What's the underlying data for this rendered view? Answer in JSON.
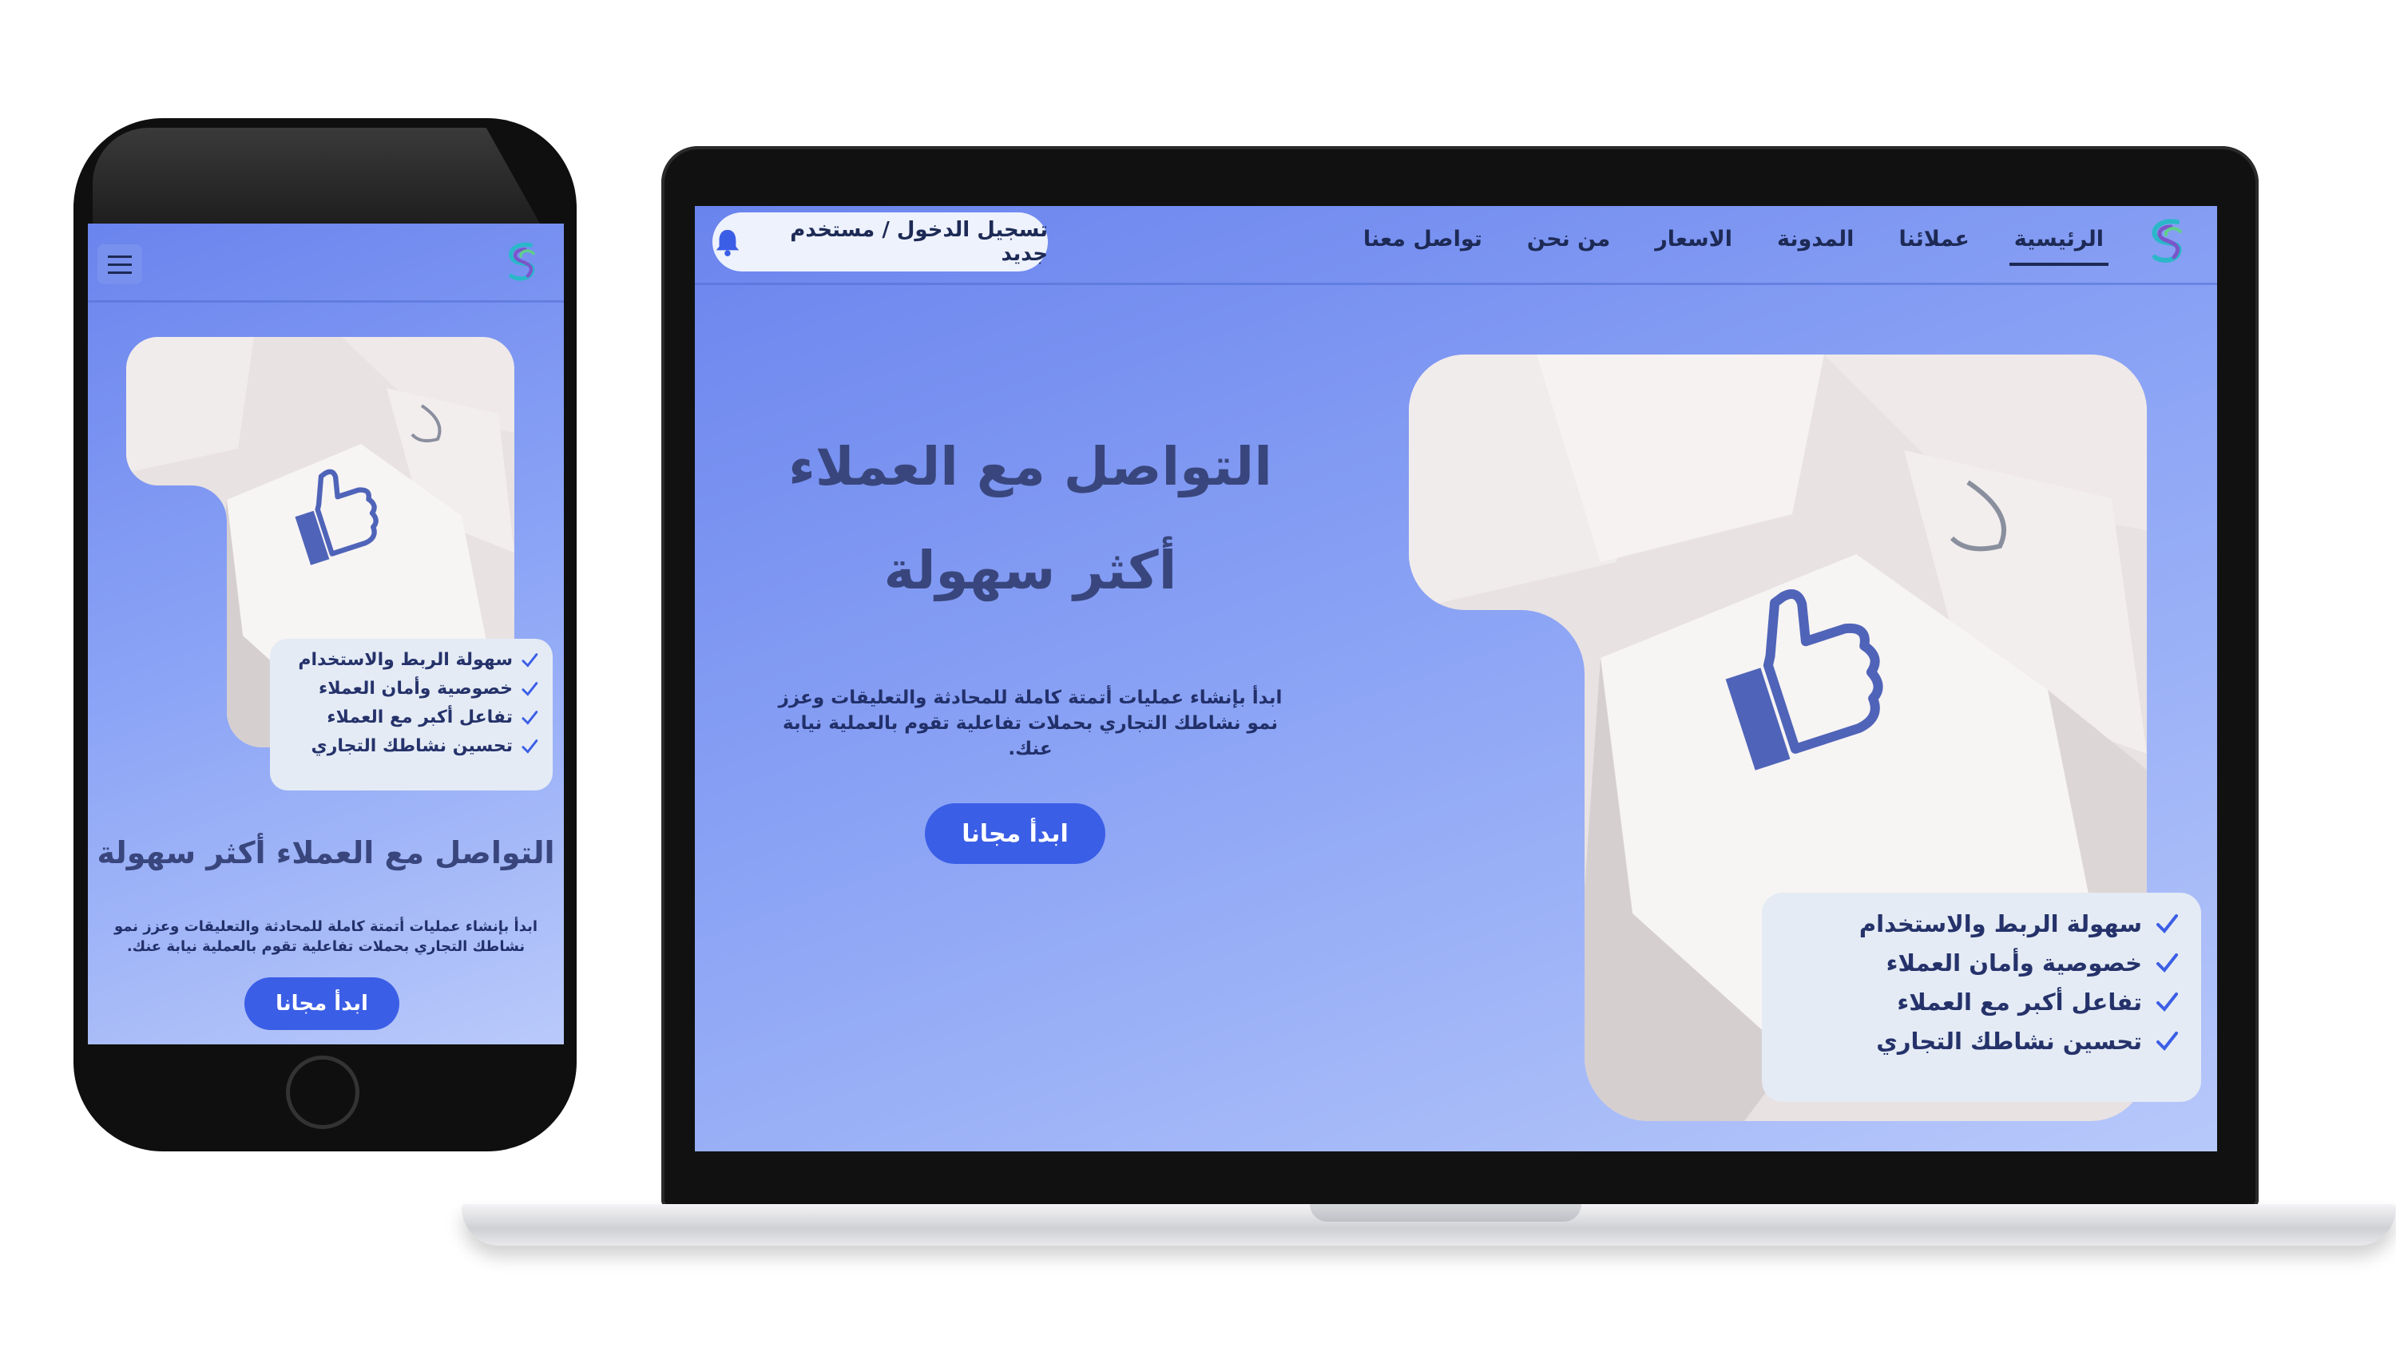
{
  "desktop": {
    "nav": {
      "items": [
        {
          "label": "الرئيسية",
          "active": true
        },
        {
          "label": "عملائنا"
        },
        {
          "label": "المدونة"
        },
        {
          "label": "الاسعار"
        },
        {
          "label": "من نحن"
        },
        {
          "label": "تواصل معنا"
        }
      ],
      "login": "تسجيل الدخول / مستخدم جديد"
    },
    "hero": {
      "title": "التواصل مع العملاء أكثر سهولة",
      "description": "ابدأ بإنشاء عمليات أتمتة كاملة للمحادثة والتعليقات وعزز نمو نشاطك التجاري بحملات تفاعلية تقوم بالعملية نيابة عنك.",
      "cta": "ابدأ مجانا"
    },
    "features": [
      "سهولة الربط والاستخدام",
      "خصوصية وأمان العملاء",
      "تفاعل أكبر مع العملاء",
      "تحسين نشاطك التجاري"
    ]
  },
  "mobile": {
    "hero": {
      "title": "التواصل مع العملاء أكثر سهولة",
      "description": "ابدأ بإنشاء عمليات أتمتة كاملة للمحادثة والتعليقات وعزز نمو نشاطك التجاري بحملات تفاعلية تقوم بالعملية نيابة عنك.",
      "cta": "ابدأ مجانا"
    },
    "features": [
      "سهولة الربط والاستخدام",
      "خصوصية وأمان العملاء",
      "تفاعل أكبر مع العملاء",
      "تحسين نشاطك التجاري"
    ]
  },
  "icons": {
    "logo": "logo-icon",
    "bell": "bell-icon",
    "check": "check-icon",
    "menu": "hamburger-menu-icon",
    "thumbs_up": "thumbs-up-icon"
  },
  "colors": {
    "accent": "#3b5ee6",
    "text": "#1d2a55",
    "check": "#3b5ee6",
    "card": "#e4ebf5"
  }
}
